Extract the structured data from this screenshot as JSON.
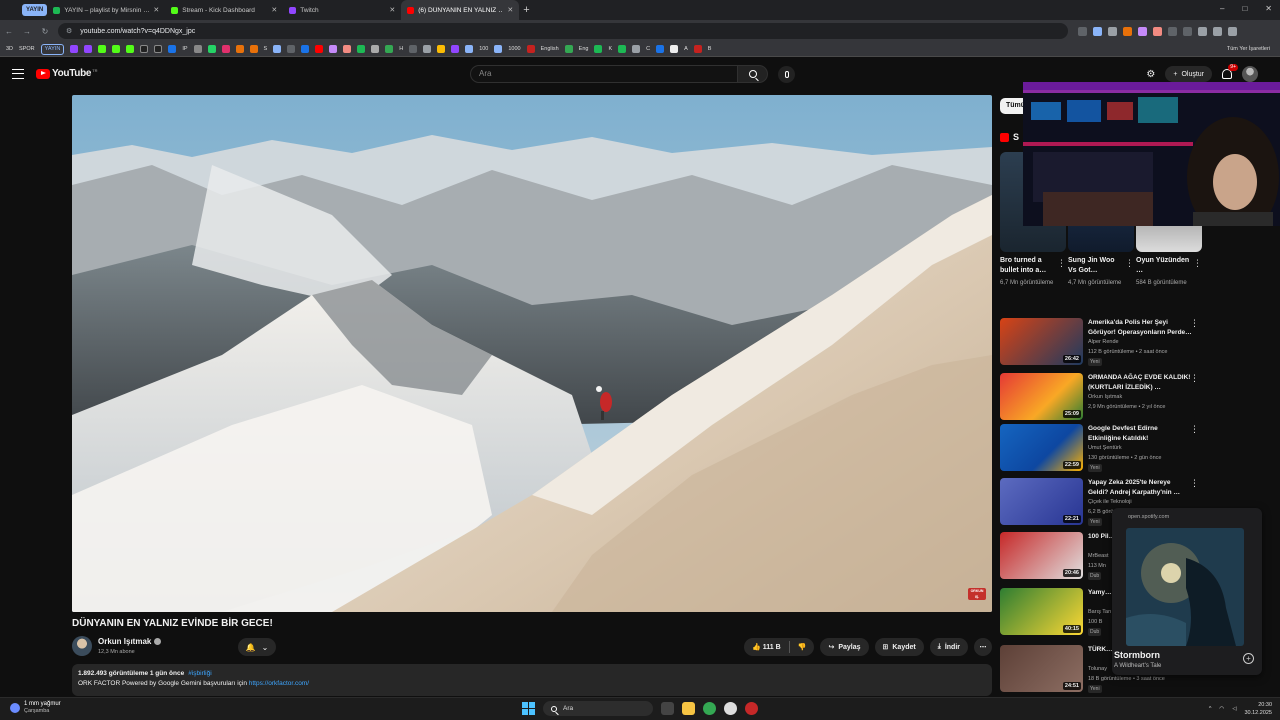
{
  "browser": {
    "group_chip": "YAYIN",
    "tabs": [
      {
        "title": "YAYIN – playlist by Mirsnin …",
        "color": "#1db954"
      },
      {
        "title": "Stream - Kick Dashboard",
        "color": "#53fc18"
      },
      {
        "title": "Twitch",
        "color": "#9146ff"
      },
      {
        "title": "(6) DÜNYANIN EN YALNIZ …",
        "color": "#ff0000"
      }
    ],
    "new_tab": "+",
    "url": "youtube.com/watch?v=q4DDNgx_jpc",
    "window_controls": [
      "–",
      "□",
      "✕"
    ],
    "bookmarks": {
      "items": [
        "3D",
        "SPOR"
      ],
      "chip": "YAYIN",
      "labels": [
        "IP",
        "S",
        "H",
        "100",
        "1000",
        "English",
        "Eng",
        "K",
        "C",
        "A",
        "B"
      ],
      "all": "Tüm Yer İşaretleri"
    }
  },
  "youtube": {
    "logo_text": "YouTube",
    "logo_country": "TR",
    "search_placeholder": "Ara",
    "create_label": "Oluştur",
    "notification_count": "9+",
    "video": {
      "title": "DÜNYANIN EN YALNIZ EVİNDE BİR GECE!",
      "corner_badge": "ORKUN IŞ."
    },
    "channel": {
      "name": "Orkun Işıtmak",
      "subs": "12,3 Mn abone"
    },
    "actions": {
      "likes": "111 B",
      "share": "Paylaş",
      "save": "Kaydet",
      "download": "İndir",
      "more": "⋯"
    },
    "description": {
      "meta": "1.892.493 görüntüleme  1 gün önce",
      "tag": "#işbirliği",
      "text": "ORK FACTOR Powered by Google Gemini başvuruları için ",
      "link": "https://orkfactor.com/"
    },
    "chip_all": "Tümü",
    "shorts_label": "S",
    "shorts": [
      {
        "title": "Bro turned a bullet into a…",
        "views": "6,7 Mn görüntüleme"
      },
      {
        "title": "Sung Jin Woo Vs Got…",
        "views": "4,7 Mn görüntüleme"
      },
      {
        "title": "Oyun Yüzünden …",
        "views": "584 B görüntüleme"
      }
    ],
    "recommendations": [
      {
        "title": "Amerika'da Polis Her Şeyi Görüyor! Operasyonların Perde…",
        "channel": "Alper Rende",
        "views": "112 B görüntüleme • 2 saat önce",
        "duration": "26:42",
        "badge": "Yeni"
      },
      {
        "title": "ORMANDA AĞAÇ EVDE KALDIK! (KURTLARI İZLEDİK) …",
        "channel": "Orkun Işıtmak",
        "views": "2,9 Mn görüntüleme • 2 yıl önce",
        "duration": "25:09",
        "badge": ""
      },
      {
        "title": "Google Devfest Edirne Etkinliğine Katıldık!",
        "channel": "Umut Şentürk",
        "views": "130 görüntüleme • 2 gün önce",
        "duration": "22:59",
        "badge": "Yeni"
      },
      {
        "title": "Yapay Zeka 2025'te Nereye Geldi? Andrej Karpathy'nin …",
        "channel": "Çiçek ile Teknoloji",
        "views": "6,2 B görüntüleme",
        "duration": "22:21",
        "badge": "Yeni"
      },
      {
        "title": "100 Pil… Ediyor…",
        "channel": "MrBeast",
        "views": "113 Mn",
        "duration": "20:46",
        "badge": "Dub"
      },
      {
        "title": "Yamy… Hayatt…",
        "channel": "Barış Tan",
        "views": "100 B",
        "duration": "40:15",
        "badge": "Dub"
      },
      {
        "title": "TÜRK… RÜME…",
        "channel": "Tolunay",
        "views": "18 B görüntüleme • 3 saat önce",
        "duration": "24:51",
        "badge": "Yeni"
      }
    ]
  },
  "spotify": {
    "url": "open.spotify.com",
    "title": "Stormborn",
    "artist": "A Wildheart's Tale",
    "add": "+"
  },
  "taskbar": {
    "weather_temp": "1 mm yağmur",
    "weather_day": "Çarşamba",
    "search": "Ara",
    "time": "20:30",
    "date": "30.12.2025"
  }
}
